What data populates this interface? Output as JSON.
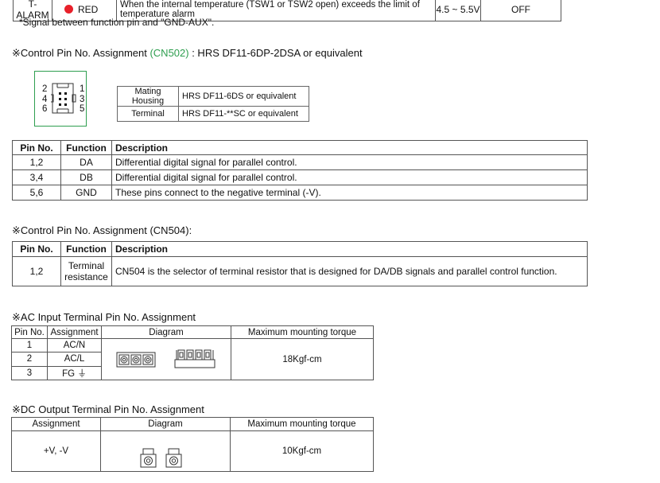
{
  "alarm_row": {
    "signal": "T-ALARM",
    "led_color_name": "RED",
    "led_color": "#e8202a",
    "description": "When the internal temperature (TSW1 or TSW2 open) exceeds the limit of temperature alarm",
    "voltage": "4.5 ~ 5.5V",
    "state": "OFF"
  },
  "note": "*Signal between function pin and \"GND-AUX\".",
  "cn502": {
    "heading_prefix": "※Control Pin No. Assignment ",
    "heading_code": "(CN502)",
    "heading_suffix": " : HRS DF11-6DP-2DSA or equivalent",
    "code_color": "#2e9e4f",
    "pins_left": [
      "2",
      "4",
      "6"
    ],
    "pins_right": [
      "1",
      "3",
      "5"
    ],
    "mating": [
      {
        "label": "Mating Housing",
        "value": "HRS DF11-6DS or equivalent"
      },
      {
        "label": "Terminal",
        "value": "HRS DF11-**SC or equivalent"
      }
    ],
    "headers": [
      "Pin No.",
      "Function",
      "Description"
    ],
    "rows": [
      {
        "pin": "1,2",
        "function": "DA",
        "description": "Differential digital signal for parallel control."
      },
      {
        "pin": "3,4",
        "function": "DB",
        "description": "Differential digital signal for parallel control."
      },
      {
        "pin": "5,6",
        "function": "GND",
        "description": "These pins connect to the negative terminal (-V)."
      }
    ]
  },
  "cn504": {
    "heading": "※Control Pin No. Assignment (CN504):",
    "headers": [
      "Pin No.",
      "Function",
      "Description"
    ],
    "rows": [
      {
        "pin": "1,2",
        "function_line1": "Terminal",
        "function_line2": "resistance",
        "description": "CN504 is the selector of terminal resistor that is designed for DA/DB signals and parallel control function."
      }
    ]
  },
  "ac": {
    "heading": "※AC Input Terminal Pin No.  Assignment",
    "headers": [
      "Pin No.",
      "Assignment",
      "Diagram",
      "Maximum mounting torque"
    ],
    "rows": [
      {
        "pin": "1",
        "assignment": "AC/N"
      },
      {
        "pin": "2",
        "assignment": "AC/L"
      },
      {
        "pin": "3",
        "assignment": "FG ⏚"
      }
    ],
    "torque": "18Kgf-cm"
  },
  "dc": {
    "heading": "※DC Output Terminal Pin No.  Assignment",
    "headers": [
      "Assignment",
      "Diagram",
      "Maximum mounting torque"
    ],
    "assignment": "+V, -V",
    "torque": "10Kgf-cm"
  }
}
